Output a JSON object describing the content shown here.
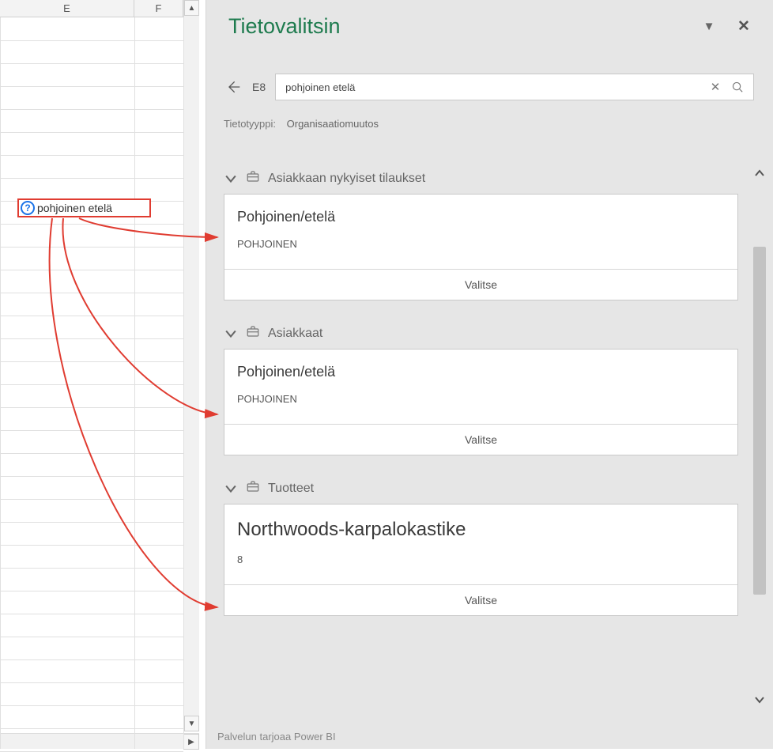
{
  "grid": {
    "col_e": "E",
    "col_f": "F",
    "cell_value": "pohjoinen etelä"
  },
  "pane": {
    "title": "Tietovalitsin",
    "cell_ref": "E8",
    "search_value": "pohjoinen etelä",
    "type_label": "Tietotyyppi:",
    "type_value": "Organisaatiomuutos",
    "footer": "Palvelun tarjoaa Power BI",
    "select_label": "Valitse",
    "sections": [
      {
        "header": "Asiakkaan nykyiset tilaukset",
        "card": {
          "title": "Pohjoinen/etelä",
          "sub": "POHJOINEN",
          "big": false
        }
      },
      {
        "header": "Asiakkaat",
        "card": {
          "title": "Pohjoinen/etelä",
          "sub": "POHJOINEN",
          "big": false
        }
      },
      {
        "header": "Tuotteet",
        "card": {
          "title": "Northwoods-karpalokastike",
          "sub": "8",
          "big": true
        }
      }
    ]
  }
}
